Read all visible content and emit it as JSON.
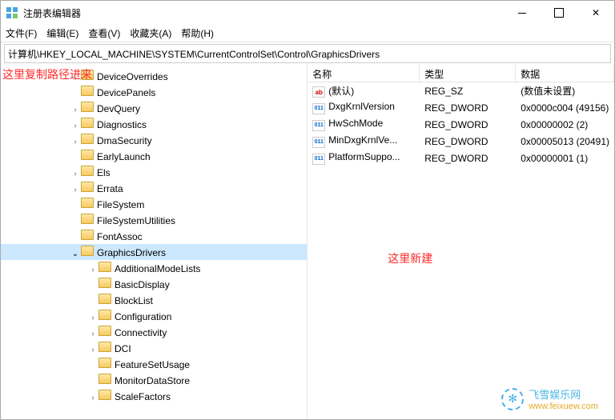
{
  "titlebar": {
    "title": "注册表编辑器"
  },
  "menu": {
    "file": "文件(F)",
    "edit": "编辑(E)",
    "view": "查看(V)",
    "favorites": "收藏夹(A)",
    "help": "帮助(H)"
  },
  "address": "计算机\\HKEY_LOCAL_MACHINE\\SYSTEM\\CurrentControlSet\\Control\\GraphicsDrivers",
  "tree": {
    "items": [
      {
        "indent": 86,
        "chev": ">",
        "label": "DeviceOverrides"
      },
      {
        "indent": 86,
        "chev": "",
        "label": "DevicePanels"
      },
      {
        "indent": 86,
        "chev": ">",
        "label": "DevQuery"
      },
      {
        "indent": 86,
        "chev": ">",
        "label": "Diagnostics"
      },
      {
        "indent": 86,
        "chev": ">",
        "label": "DmaSecurity"
      },
      {
        "indent": 86,
        "chev": "",
        "label": "EarlyLaunch"
      },
      {
        "indent": 86,
        "chev": ">",
        "label": "Els"
      },
      {
        "indent": 86,
        "chev": ">",
        "label": "Errata"
      },
      {
        "indent": 86,
        "chev": "",
        "label": "FileSystem"
      },
      {
        "indent": 86,
        "chev": "",
        "label": "FileSystemUtilities"
      },
      {
        "indent": 86,
        "chev": "",
        "label": "FontAssoc"
      },
      {
        "indent": 86,
        "chev": "v",
        "label": "GraphicsDrivers",
        "selected": true
      },
      {
        "indent": 108,
        "chev": ">",
        "label": "AdditionalModeLists"
      },
      {
        "indent": 108,
        "chev": "",
        "label": "BasicDisplay"
      },
      {
        "indent": 108,
        "chev": "",
        "label": "BlockList"
      },
      {
        "indent": 108,
        "chev": ">",
        "label": "Configuration"
      },
      {
        "indent": 108,
        "chev": ">",
        "label": "Connectivity"
      },
      {
        "indent": 108,
        "chev": ">",
        "label": "DCI"
      },
      {
        "indent": 108,
        "chev": "",
        "label": "FeatureSetUsage"
      },
      {
        "indent": 108,
        "chev": "",
        "label": "MonitorDataStore"
      },
      {
        "indent": 108,
        "chev": ">",
        "label": "ScaleFactors"
      }
    ]
  },
  "list": {
    "header": {
      "name": "名称",
      "type": "类型",
      "data": "数据"
    },
    "rows": [
      {
        "icon": "str",
        "name": "(默认)",
        "type": "REG_SZ",
        "data": "(数值未设置)"
      },
      {
        "icon": "dw",
        "name": "DxgKrnlVersion",
        "type": "REG_DWORD",
        "data": "0x0000c004 (49156)"
      },
      {
        "icon": "dw",
        "name": "HwSchMode",
        "type": "REG_DWORD",
        "data": "0x00000002 (2)"
      },
      {
        "icon": "dw",
        "name": "MinDxgKrnlVe...",
        "type": "REG_DWORD",
        "data": "0x00005013 (20491)"
      },
      {
        "icon": "dw",
        "name": "PlatformSuppo...",
        "type": "REG_DWORD",
        "data": "0x00000001 (1)"
      }
    ]
  },
  "annot": {
    "left": "这里复制路径进来",
    "right": "这里新建"
  },
  "watermark": {
    "line1": "飞雪娱乐网",
    "line2": "www.feixuew.com"
  }
}
